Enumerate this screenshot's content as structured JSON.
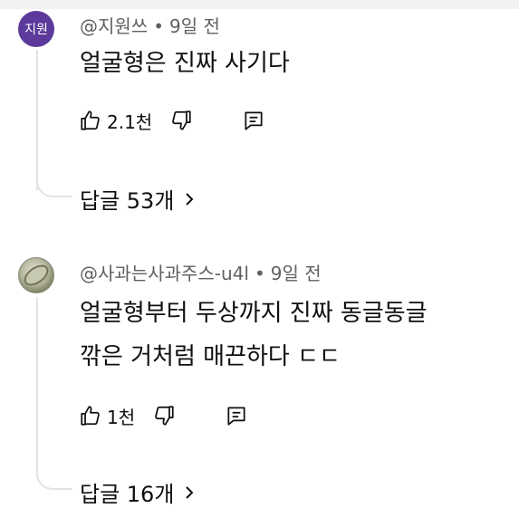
{
  "comments": [
    {
      "avatar_text": "지원",
      "handle": "@지원쓰",
      "separator": "•",
      "time": "9일 전",
      "lines": [
        "얼굴형은 진짜 사기다"
      ],
      "likes": "2.1천",
      "replies_label": "답글 53개"
    },
    {
      "handle": "@사과는사과주스-u4l",
      "separator": "•",
      "time": "9일 전",
      "lines": [
        "얼굴형부터 두상까지 진짜 동글동글",
        "깎은 거처럼 매끈하다 ㄷㄷ"
      ],
      "likes": "1천",
      "replies_label": "답글 16개"
    }
  ],
  "icons": {
    "like": "thumbs-up-icon",
    "dislike": "thumbs-down-icon",
    "reply": "comment-icon",
    "expand": "chevron-right-icon"
  },
  "colors": {
    "avatar1_bg": "#5b3a9c",
    "meta_text": "#606060",
    "thread_line": "#e3e3e3"
  }
}
